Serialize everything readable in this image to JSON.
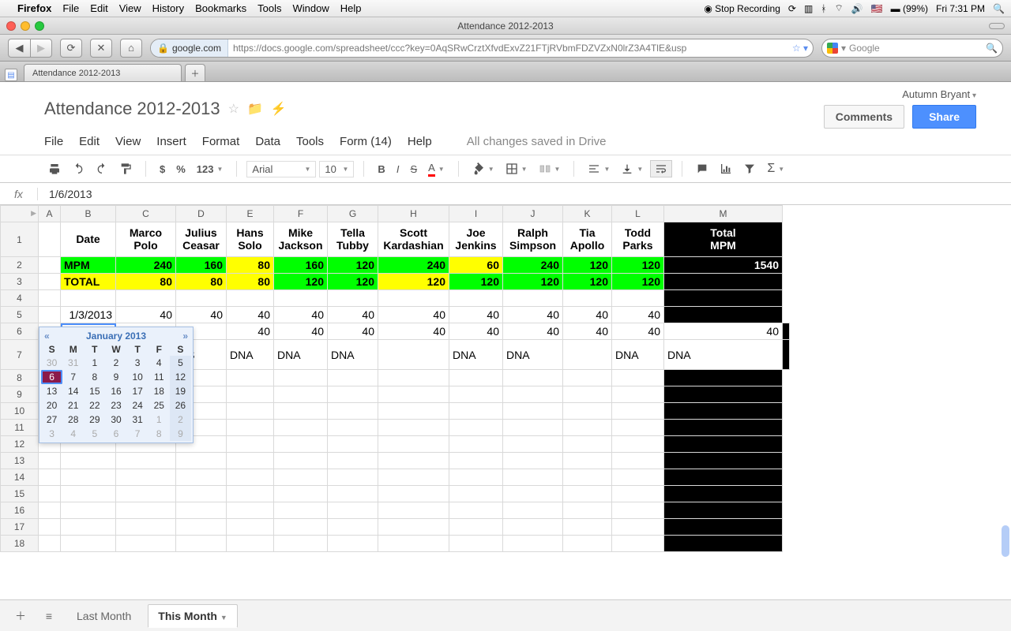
{
  "mac": {
    "app": "Firefox",
    "menus": [
      "File",
      "Edit",
      "View",
      "History",
      "Bookmarks",
      "Tools",
      "Window",
      "Help"
    ],
    "stop_rec": "Stop Recording",
    "battery": "(99%)",
    "time": "Fri 7:31 PM"
  },
  "window": {
    "title": "Attendance 2012-2013"
  },
  "browser": {
    "host": "google.com",
    "url": "https://docs.google.com/spreadsheet/ccc?key=0AqSRwCrztXfvdExvZ21FTjRVbmFDZVZxN0lrZ3A4TlE&usp",
    "search_placeholder": "Google",
    "tab_label": "Attendance 2012-2013"
  },
  "doc": {
    "title": "Attendance 2012-2013",
    "user": "Autumn Bryant",
    "comments": "Comments",
    "share": "Share",
    "menus": [
      "File",
      "Edit",
      "View",
      "Insert",
      "Format",
      "Data",
      "Tools",
      "Form (14)",
      "Help"
    ],
    "status": "All changes saved in Drive"
  },
  "toolbar": {
    "font": "Arial",
    "size": "10",
    "num123": "123",
    "dollar": "$",
    "percent": "%"
  },
  "fx": {
    "value": "1/6/2013"
  },
  "cols": {
    "letters": [
      "A",
      "B",
      "C",
      "D",
      "E",
      "F",
      "G",
      "H",
      "I",
      "J",
      "K",
      "L",
      "M"
    ],
    "widths": [
      28,
      70,
      76,
      64,
      60,
      68,
      64,
      90,
      68,
      76,
      62,
      66,
      150
    ],
    "headers": [
      "",
      "Date",
      "Marco Polo",
      "Julius Ceasar",
      "Hans Solo",
      "Mike Jackson",
      "Tella Tubby",
      "Scott Kardashian",
      "Joe Jenkins",
      "Ralph Simpson",
      "Tia Apollo",
      "Todd Parks",
      "Total MPM"
    ]
  },
  "rows": {
    "mpm": {
      "label": "MPM",
      "v": [
        240,
        160,
        80,
        160,
        120,
        240,
        60,
        240,
        120,
        120
      ],
      "total": 1540
    },
    "total": {
      "label": "TOTAL",
      "v": [
        80,
        80,
        80,
        120,
        120,
        120,
        120,
        120,
        120,
        120
      ]
    },
    "r5": {
      "date": "1/3/2013",
      "v": [
        40,
        40,
        40,
        40,
        40,
        40,
        40,
        40,
        40,
        40
      ]
    },
    "r6": {
      "date": "1/6/2013",
      "v": [
        "A",
        "",
        40,
        40,
        40,
        40,
        40,
        40,
        40,
        40,
        40
      ]
    },
    "r7": {
      "v": [
        "S",
        "",
        "NS",
        "DNA",
        "DNA",
        "DNA",
        "",
        "DNA",
        "DNA",
        "",
        "DNA",
        "DNA"
      ]
    }
  },
  "datepicker": {
    "title": "January 2013",
    "dows": [
      "S",
      "M",
      "T",
      "W",
      "T",
      "F",
      "S"
    ],
    "days": [
      {
        "n": 30,
        "o": 1
      },
      {
        "n": 31,
        "o": 1
      },
      {
        "n": 1
      },
      {
        "n": 2
      },
      {
        "n": 3
      },
      {
        "n": 4
      },
      {
        "n": 5,
        "we": 1
      },
      {
        "n": 6,
        "sel": 1
      },
      {
        "n": 7
      },
      {
        "n": 8
      },
      {
        "n": 9
      },
      {
        "n": 10
      },
      {
        "n": 11
      },
      {
        "n": 12,
        "we": 1
      },
      {
        "n": 13
      },
      {
        "n": 14
      },
      {
        "n": 15
      },
      {
        "n": 16
      },
      {
        "n": 17
      },
      {
        "n": 18
      },
      {
        "n": 19,
        "we": 1
      },
      {
        "n": 20
      },
      {
        "n": 21
      },
      {
        "n": 22
      },
      {
        "n": 23
      },
      {
        "n": 24
      },
      {
        "n": 25
      },
      {
        "n": 26,
        "we": 1
      },
      {
        "n": 27
      },
      {
        "n": 28
      },
      {
        "n": 29
      },
      {
        "n": 30
      },
      {
        "n": 31
      },
      {
        "n": 1,
        "o": 1
      },
      {
        "n": 2,
        "o": 1,
        "we": 1
      },
      {
        "n": 3,
        "o": 1
      },
      {
        "n": 4,
        "o": 1
      },
      {
        "n": 5,
        "o": 1
      },
      {
        "n": 6,
        "o": 1
      },
      {
        "n": 7,
        "o": 1
      },
      {
        "n": 8,
        "o": 1
      },
      {
        "n": 9,
        "o": 1,
        "we": 1
      }
    ]
  },
  "sheets": {
    "tabs": [
      "Last Month",
      "This Month"
    ],
    "active": 1
  }
}
